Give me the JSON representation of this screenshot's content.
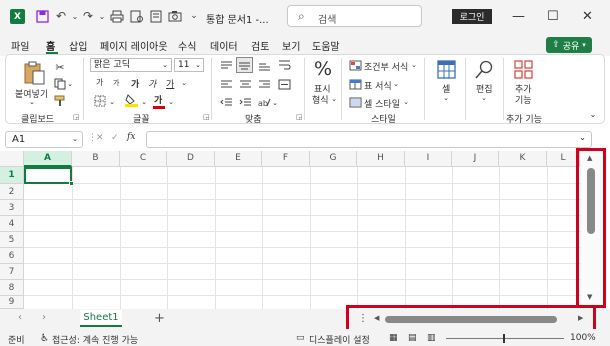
{
  "titlebar": {
    "app_icon": "X",
    "document_title": "통합 문서1 -...",
    "search_placeholder": "검색",
    "login_label": "로그인",
    "icons": [
      "save-icon",
      "undo-icon",
      "redo-icon",
      "print-icon",
      "print-preview-icon",
      "camera-icon",
      "more-icon"
    ],
    "window_controls": [
      "minimize-icon",
      "maximize-icon",
      "close-icon"
    ]
  },
  "menu": {
    "tabs": [
      "파일",
      "홈",
      "삽입",
      "페이지 레이아웃",
      "수식",
      "데이터",
      "검토",
      "보기",
      "도움말"
    ],
    "active_tab": "홈",
    "share_label": "공유"
  },
  "ribbon": {
    "clipboard": {
      "paste_label": "붙여넣기",
      "group_label": "클립보드"
    },
    "font": {
      "font_name": "맑은 고딕",
      "font_size": "11",
      "increase": "가",
      "decrease": "가",
      "bold": "가",
      "italic": "가",
      "underline": "가",
      "font_color_glyph": "가",
      "group_label": "글꼴"
    },
    "alignment": {
      "group_label": "맞춤"
    },
    "number": {
      "label_line1": "표시",
      "label_line2": "형식",
      "percent": "%",
      "group_label": ""
    },
    "styles": {
      "conditional": "조건부 서식",
      "table": "표 서식",
      "cell_style": "셀 스타일",
      "group_label": "스타일"
    },
    "cells": {
      "label": "셀"
    },
    "editing": {
      "label": "편집"
    },
    "addins": {
      "label_line1": "추가",
      "label_line2": "기능",
      "group_label": "추가 기능"
    }
  },
  "formula_bar": {
    "name_box": "A1",
    "fx": "fx",
    "cancel": "✕",
    "enter": "✓"
  },
  "grid": {
    "columns": [
      "A",
      "B",
      "C",
      "D",
      "E",
      "F",
      "G",
      "H",
      "I",
      "J",
      "K",
      "L"
    ],
    "rows": [
      "1",
      "2",
      "3",
      "4",
      "5",
      "6",
      "7",
      "8",
      "9"
    ],
    "active_cell": "A1"
  },
  "sheets": {
    "tabs": [
      "Sheet1"
    ],
    "add_label": "+"
  },
  "status": {
    "ready": "준비",
    "accessibility": "접근성: 계속 진행 가능",
    "display_settings": "디스플레이 설정",
    "zoom": "100%"
  }
}
